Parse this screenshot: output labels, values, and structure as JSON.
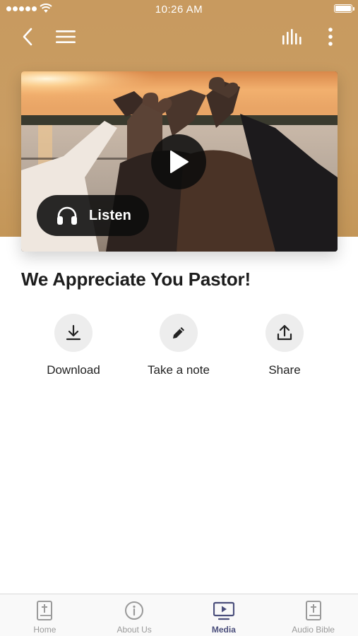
{
  "status_bar": {
    "time": "10:26 AM",
    "battery_level": 0.9
  },
  "nav": {
    "back_icon": "chevron-left-icon",
    "menu_icon": "hamburger-menu-icon",
    "stats_icon": "audio-bars-icon",
    "more_icon": "more-vertical-icon"
  },
  "media": {
    "listen_label": "Listen",
    "play_icon": "play-icon",
    "listen_icon": "headphones-icon"
  },
  "title": "We Appreciate You Pastor!",
  "actions": [
    {
      "label": "Download",
      "icon": "download-icon"
    },
    {
      "label": "Take a note",
      "icon": "pencil-icon"
    },
    {
      "label": "Share",
      "icon": "share-icon"
    }
  ],
  "tabs": [
    {
      "label": "Home",
      "icon": "bible-icon",
      "active": false
    },
    {
      "label": "About Us",
      "icon": "info-icon",
      "active": false
    },
    {
      "label": "Media",
      "icon": "tv-play-icon",
      "active": true
    },
    {
      "label": "Audio Bible",
      "icon": "bible-icon",
      "active": false
    }
  ],
  "colors": {
    "header_bg": "#c89a5f",
    "accent": "#4b4f7c",
    "tab_inactive": "#9a9a9a",
    "action_circle": "#ededed"
  }
}
